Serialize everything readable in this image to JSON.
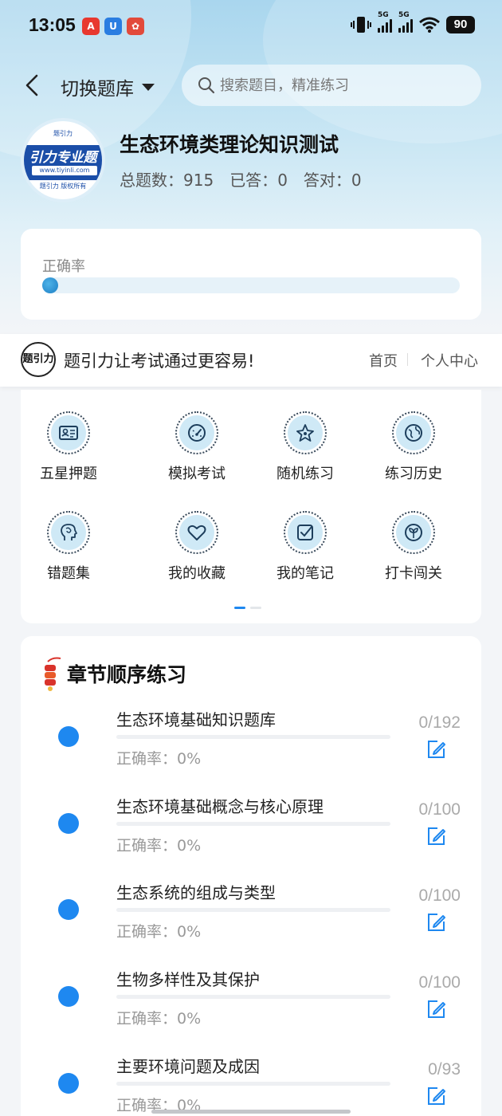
{
  "status_bar": {
    "time": "13:05",
    "battery": "90",
    "sim1": "5G",
    "sim2": "5G"
  },
  "header": {
    "switch_label": "切换题库",
    "search_placeholder": "搜索题目，精准练习"
  },
  "bank": {
    "logo_title": "引力专业题",
    "logo_url": "www.tiyinli.com",
    "logo_foot": "题引力 版权所有",
    "logo_top": "题引力",
    "title": "生态环境类理论知识测试",
    "stats": {
      "total_label": "总题数：",
      "total": "915",
      "answered_label": "已答：",
      "answered": "0",
      "correct_label": "答对：",
      "correct": "0"
    }
  },
  "accuracy": {
    "label": "正确率",
    "value": 0
  },
  "slogan": {
    "logo_text": "题引力",
    "text": "题引力让考试通过更容易!",
    "home": "首页",
    "user_center": "个人中心"
  },
  "grid": {
    "items": [
      {
        "label": "五星押题",
        "icon": "id-card-icon"
      },
      {
        "label": "模拟考试",
        "icon": "speedometer-icon"
      },
      {
        "label": "随机练习",
        "icon": "star-network-icon"
      },
      {
        "label": "练习历史",
        "icon": "globe-history-icon"
      },
      {
        "label": "错题集",
        "icon": "head-brain-icon"
      },
      {
        "label": "我的收藏",
        "icon": "heart-icon"
      },
      {
        "label": "我的笔记",
        "icon": "checkbox-note-icon"
      },
      {
        "label": "打卡闯关",
        "icon": "sprout-badge-icon"
      }
    ],
    "page_indicator": {
      "pages": 2,
      "active": 0
    },
    "accent": "#1e88f0"
  },
  "chapters": {
    "title": "章节顺序练习",
    "accuracy_label": "正确率：",
    "items": [
      {
        "name": "生态环境基础知识题库",
        "accuracy": "0%",
        "count": "0/192"
      },
      {
        "name": "生态环境基础概念与核心原理",
        "accuracy": "0%",
        "count": "0/100"
      },
      {
        "name": "生态系统的组成与类型",
        "accuracy": "0%",
        "count": "0/100"
      },
      {
        "name": "生物多样性及其保护",
        "accuracy": "0%",
        "count": "0/100"
      },
      {
        "name": "主要环境问题及成因",
        "accuracy": "0%",
        "count": "0/93"
      }
    ]
  }
}
